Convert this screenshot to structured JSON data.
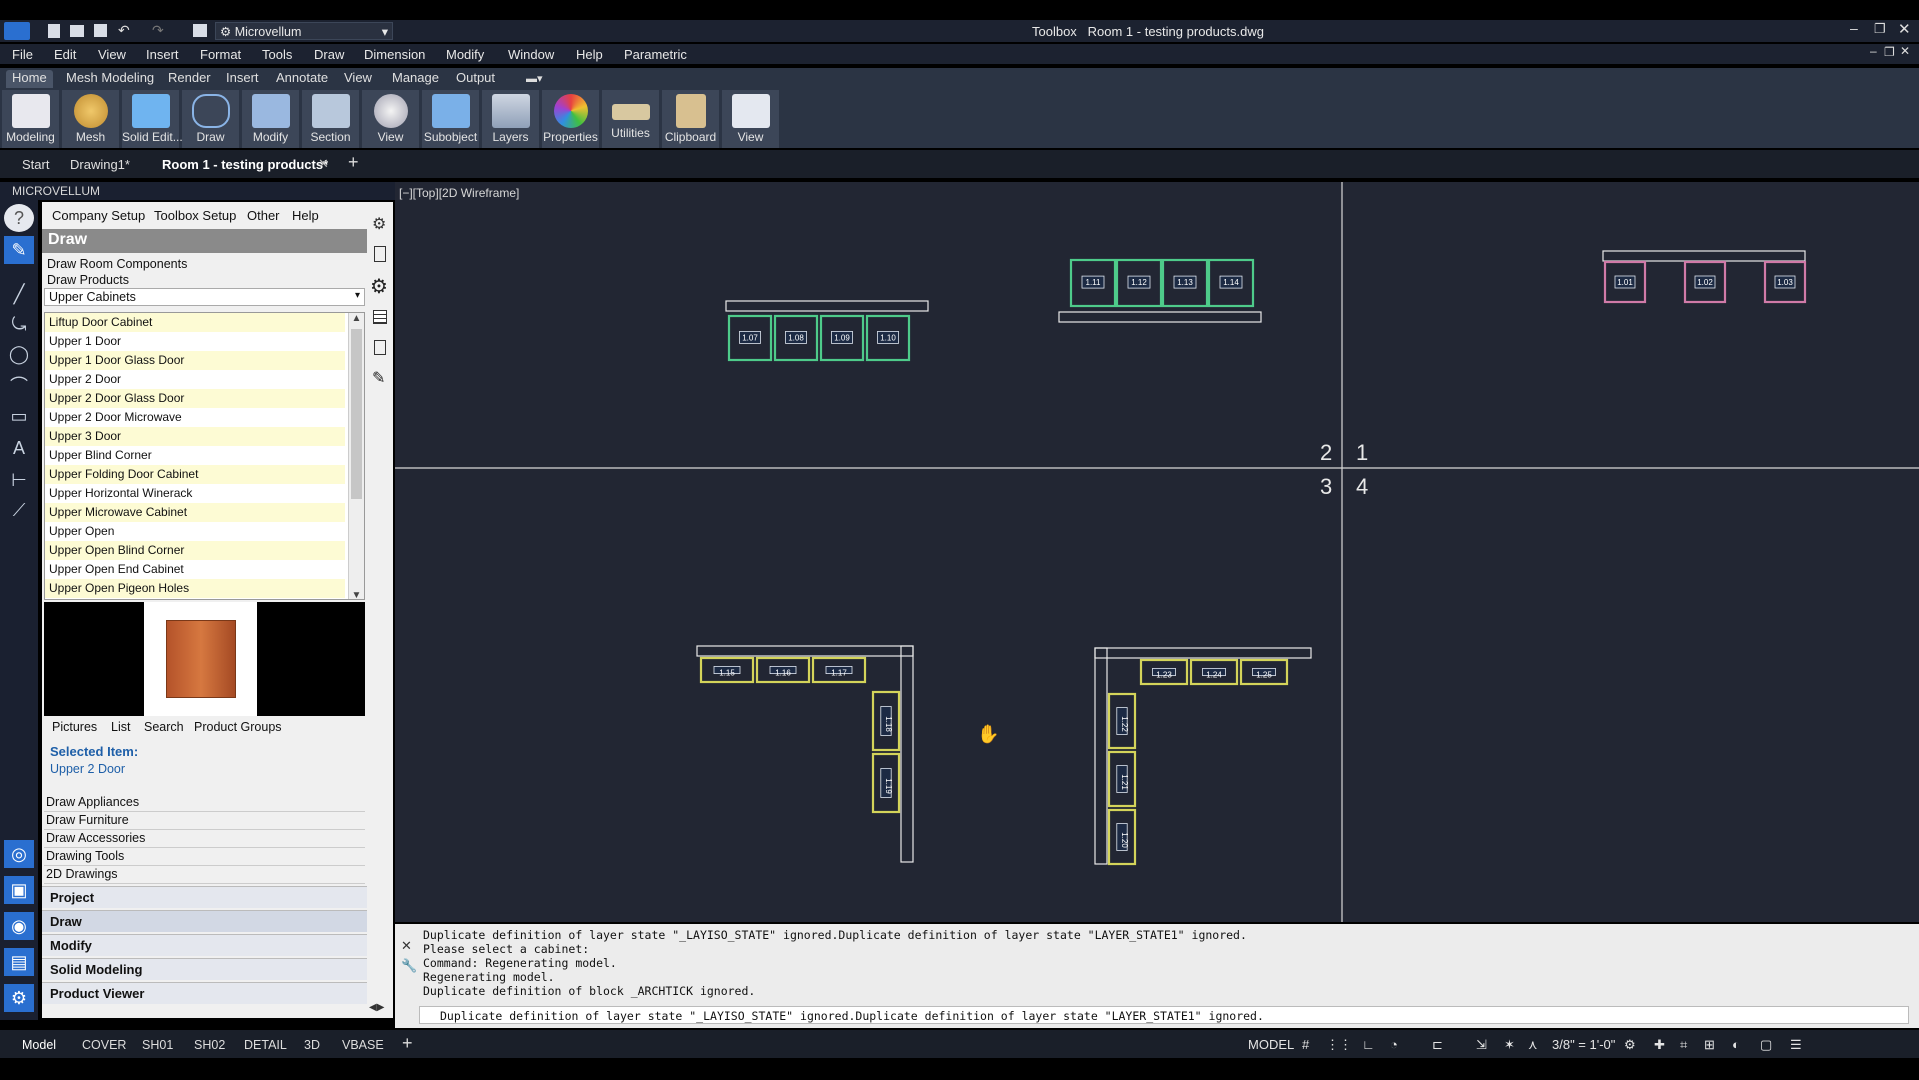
{
  "app": {
    "quick_access_workspace": "Microvellum",
    "window_title": "Toolbox   Room 1 - testing products.dwg"
  },
  "menu": [
    "File",
    "Edit",
    "View",
    "Insert",
    "Format",
    "Tools",
    "Draw",
    "Dimension",
    "Modify",
    "Window",
    "Help",
    "Parametric"
  ],
  "ribbon_tabs": [
    "Home",
    "Mesh Modeling",
    "Render",
    "Insert",
    "Annotate",
    "View",
    "Manage",
    "Output"
  ],
  "ribbon_buttons": [
    "Modeling",
    "Mesh",
    "Solid Edit...",
    "Draw",
    "Modify",
    "Section",
    "View",
    "Subobject",
    "Layers",
    "Properties",
    "Utilities",
    "Clipboard",
    "View"
  ],
  "doc_tabs": [
    "Start",
    "Drawing1*",
    "Room 1 - testing products*"
  ],
  "panel": {
    "title": "MICROVELLUM",
    "menu": [
      "Company Setup",
      "Toolbox Setup",
      "Other",
      "Help"
    ],
    "section_header": "Draw",
    "links": [
      "Draw Room Components",
      "Draw Products"
    ],
    "category": "Upper Cabinets",
    "products": [
      "Liftup Door Cabinet",
      "Upper 1 Door",
      "Upper 1 Door Glass Door",
      "Upper 2 Door",
      "Upper 2 Door Glass Door",
      "Upper 2 Door Microwave",
      "Upper 3 Door",
      "Upper Blind Corner",
      "Upper Folding Door Cabinet",
      "Upper Horizontal Winerack",
      "Upper Microwave Cabinet",
      "Upper Open",
      "Upper Open Blind Corner",
      "Upper Open End Cabinet",
      "Upper Open Pigeon Holes"
    ],
    "view_tabs": [
      "Pictures",
      "List",
      "Search",
      "Product Groups"
    ],
    "selected_label": "Selected Item:",
    "selected_value": "Upper 2 Door",
    "lower_links": [
      "Draw Appliances",
      "Draw Furniture",
      "Draw Accessories",
      "Drawing Tools",
      "2D Drawings"
    ],
    "groups": [
      "Project",
      "Draw",
      "Modify",
      "Solid Modeling",
      "Product Viewer"
    ]
  },
  "viewport": {
    "label": "[−][Top][2D Wireframe]",
    "quadrants": [
      "2",
      "1",
      "3",
      "4"
    ],
    "cabinet_labels": {
      "q2_bottom": [
        "1.07",
        "1.08",
        "1.09",
        "1.10"
      ],
      "q2_top": [
        "1.11",
        "1.12",
        "1.13",
        "1.14"
      ],
      "q1": [
        "1.01",
        "1.02",
        "1.03"
      ],
      "q3_row": [
        "1.15",
        "1.16",
        "1.17"
      ],
      "q3_col": [
        "1.18",
        "1.19"
      ],
      "q4_row": [
        "1.23",
        "1.24",
        "1.25"
      ],
      "q4_col": [
        "1.22",
        "1.21",
        "1.20"
      ]
    }
  },
  "command": {
    "history": [
      "Duplicate definition of layer state \"_LAYISO_STATE\" ignored.Duplicate definition of layer state \"LAYER_STATE1\" ignored.",
      "Please select a cabinet:",
      "Command: Regenerating model.",
      "Regenerating model.",
      "Duplicate definition of block _ARCHTICK  ignored."
    ],
    "current": "Duplicate definition of layer state \"_LAYISO_STATE\" ignored.Duplicate definition of layer state \"LAYER_STATE1\" ignored."
  },
  "layout_tabs": [
    "Model",
    "COVER",
    "SH01",
    "SH02",
    "DETAIL",
    "3D",
    "VBASE"
  ],
  "status": {
    "space": "MODEL",
    "scale": "3/8\" = 1'-0\""
  },
  "colors": {
    "viewport_bg": "#222633",
    "cabinet_green": "#4ecb8a",
    "cabinet_yellow": "#d4d45a",
    "cabinet_pink": "#d07aa8",
    "selected_text": "#1e5fa8"
  }
}
